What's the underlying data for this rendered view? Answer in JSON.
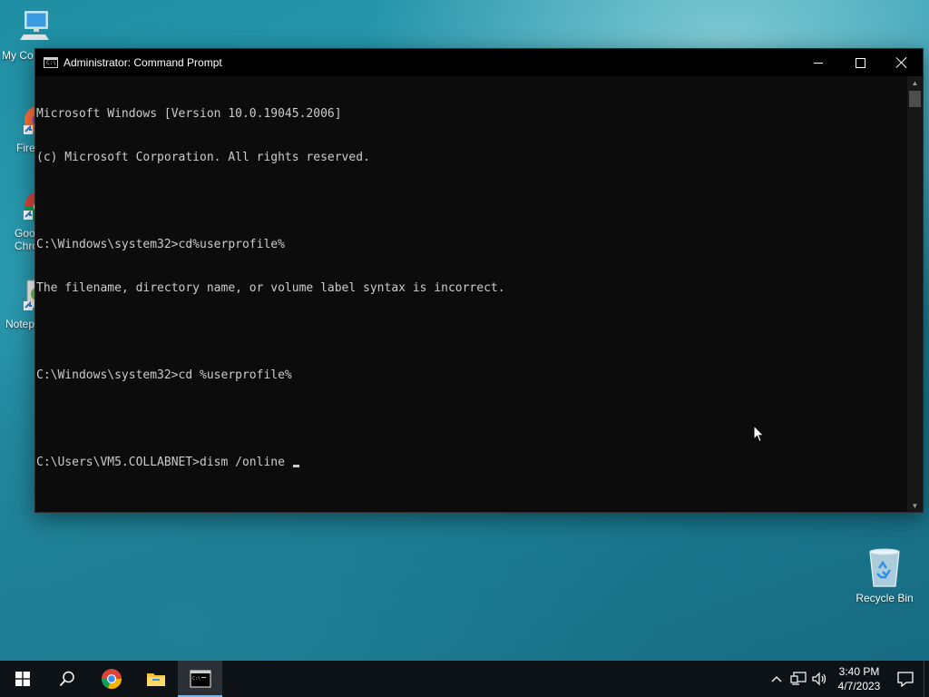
{
  "desktop": {
    "icons": [
      {
        "label": "My Co",
        "icon": "computer-icon"
      },
      {
        "label": "Fire",
        "icon": "firefox-icon"
      },
      {
        "label": "Goo",
        "label2": "Chro",
        "icon": "chrome-icon"
      },
      {
        "label": "Notep",
        "icon": "notepad-icon"
      }
    ],
    "recycle_bin": {
      "label": "Recycle Bin",
      "icon": "recycle-bin-icon"
    }
  },
  "window": {
    "title": "Administrator: Command Prompt",
    "controls": {
      "minimize": "minimize",
      "maximize": "maximize",
      "close": "close"
    }
  },
  "console": {
    "lines": [
      "Microsoft Windows [Version 10.0.19045.2006]",
      "(c) Microsoft Corporation. All rights reserved.",
      "",
      "C:\\Windows\\system32>cd%userprofile%",
      "The filename, directory name, or volume label syntax is incorrect.",
      "",
      "C:\\Windows\\system32>cd %userprofile%",
      "",
      "C:\\Users\\VM5.COLLABNET>dism /online "
    ]
  },
  "taskbar": {
    "buttons": [
      {
        "name": "start-button",
        "icon": "windows-logo-icon"
      },
      {
        "name": "search-button",
        "icon": "search-icon"
      },
      {
        "name": "chrome-taskbar-button",
        "icon": "chrome-icon"
      },
      {
        "name": "file-explorer-taskbar-button",
        "icon": "folder-icon"
      },
      {
        "name": "cmd-taskbar-button",
        "icon": "cmd-icon",
        "active": true
      }
    ],
    "tray": {
      "time": "3:40 PM",
      "date": "4/7/2023"
    }
  },
  "colors": {
    "console_bg": "#0c0c0c",
    "console_fg": "#cccccc",
    "taskbar_bg": "#0d1216",
    "active_indicator": "#7fb5e0"
  }
}
